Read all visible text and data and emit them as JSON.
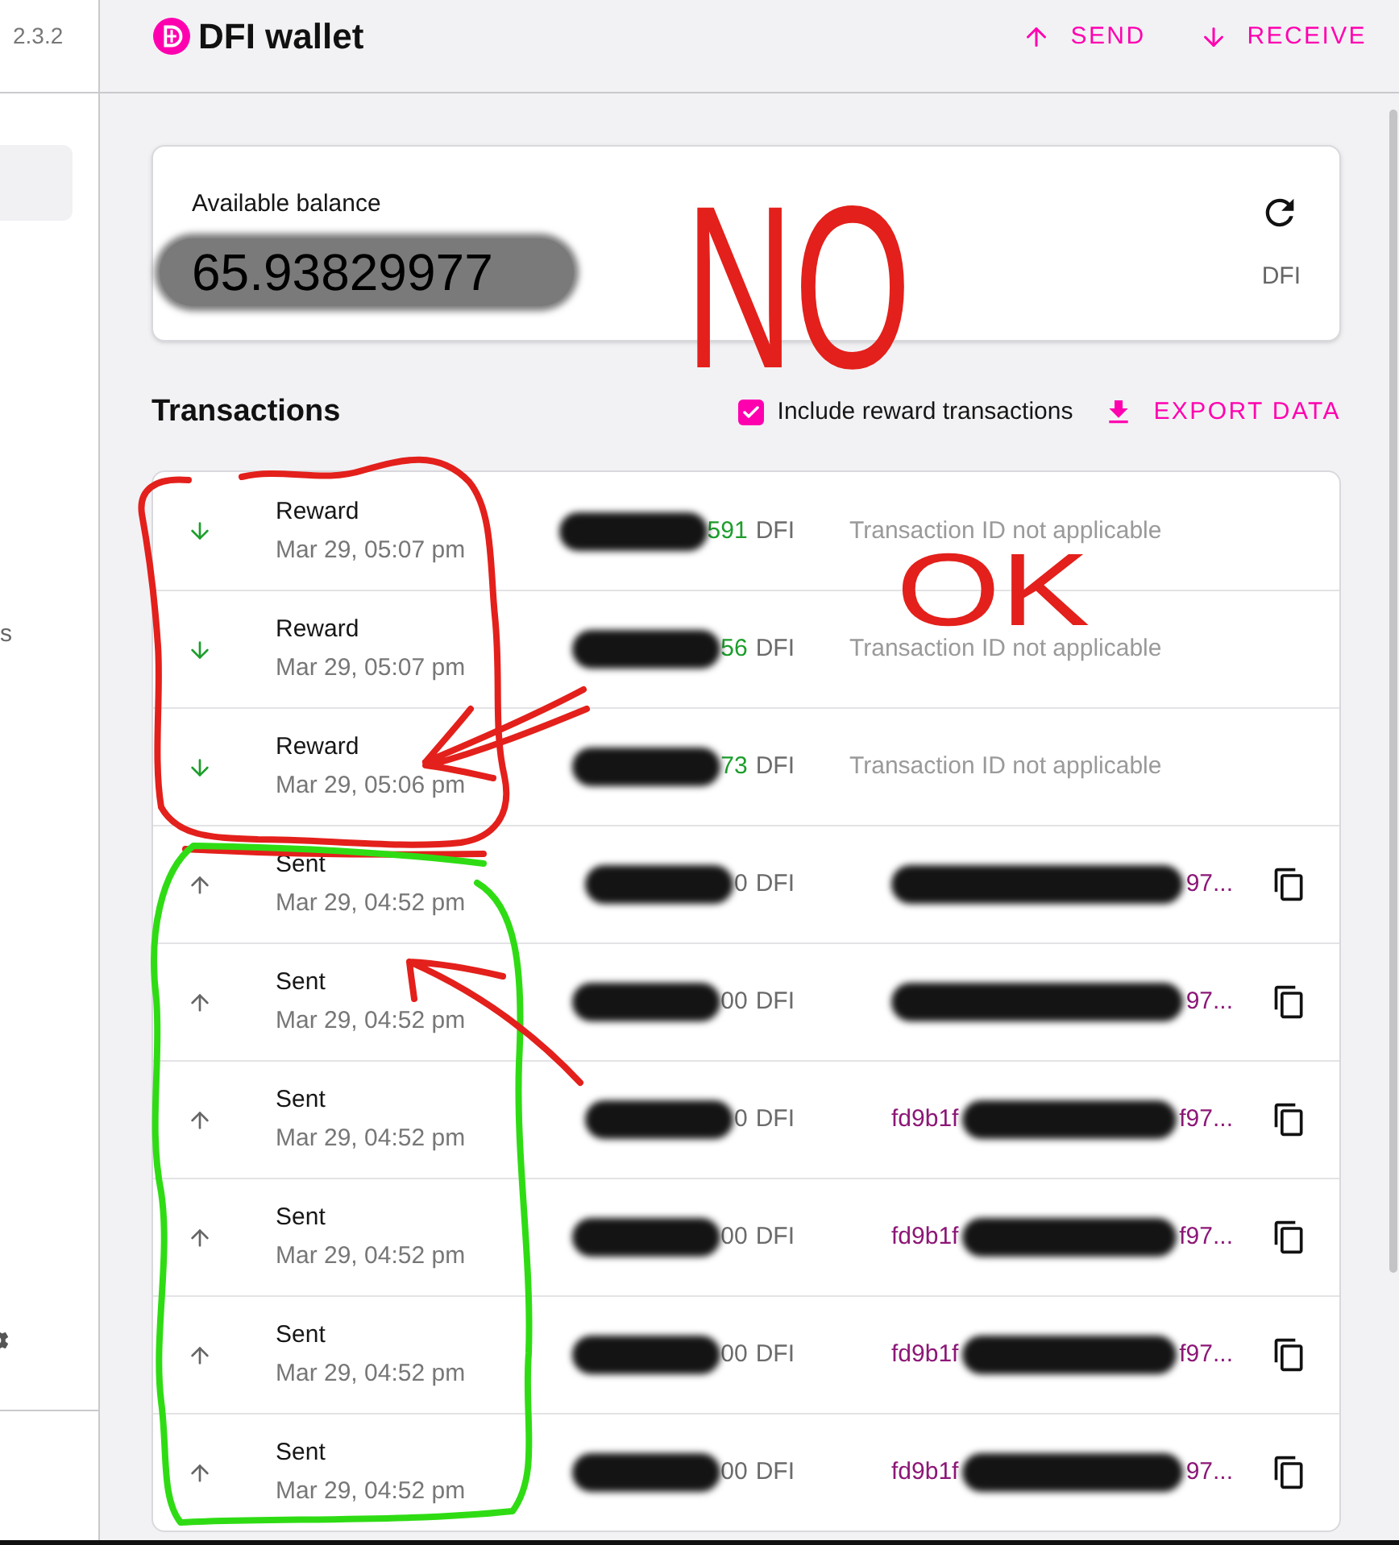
{
  "sidebar": {
    "version": "2.3.2",
    "items": [
      {
        "selected": true
      },
      {
        "label": "s",
        "selected": false
      }
    ]
  },
  "header": {
    "title": "DFI wallet",
    "actions": [
      {
        "kind": "send",
        "label": "SEND"
      },
      {
        "kind": "receive",
        "label": "RECEIVE"
      }
    ]
  },
  "balance": {
    "label": "Available balance",
    "amount": "65.93829977",
    "unit": "DFI"
  },
  "transactions": {
    "title": "Transactions",
    "filter": {
      "label": "Include reward transactions",
      "checked": true
    },
    "export": "EXPORT DATA",
    "rows": [
      {
        "kind": "reward",
        "type": "Reward",
        "date": "Mar 29, 05:07 pm",
        "amount": "591",
        "unit": "DFI",
        "txid": "Transaction ID not applicable"
      },
      {
        "kind": "reward",
        "type": "Reward",
        "date": "Mar 29, 05:07 pm",
        "amount": "56",
        "unit": "DFI",
        "txid": "Transaction ID not applicable"
      },
      {
        "kind": "reward",
        "type": "Reward",
        "date": "Mar 29, 05:06 pm",
        "amount": "73",
        "unit": "DFI",
        "txid": "Transaction ID not applicable"
      },
      {
        "kind": "sent",
        "type": "Sent",
        "date": "Mar 29, 04:52 pm",
        "amount": "0",
        "unit": "DFI",
        "txid_end": "97..."
      },
      {
        "kind": "sent",
        "type": "Sent",
        "date": "Mar 29, 04:52 pm",
        "amount": "00",
        "unit": "DFI",
        "txid_end": "97..."
      },
      {
        "kind": "sent",
        "type": "Sent",
        "date": "Mar 29, 04:52 pm",
        "amount": "0",
        "unit": "DFI",
        "txid_start": "fd9b1f",
        "txid_end": "f97..."
      },
      {
        "kind": "sent",
        "type": "Sent",
        "date": "Mar 29, 04:52 pm",
        "amount": "00",
        "unit": "DFI",
        "txid_start": "fd9b1f",
        "txid_end": "f97..."
      },
      {
        "kind": "sent",
        "type": "Sent",
        "date": "Mar 29, 04:52 pm",
        "amount": "00",
        "unit": "DFI",
        "txid_start": "fd9b1f",
        "txid_end": "f97..."
      },
      {
        "kind": "sent",
        "type": "Sent",
        "date": "Mar 29, 04:52 pm",
        "amount": "00",
        "unit": "DFI",
        "txid_start": "fd9b1f",
        "txid_end": "97..."
      }
    ]
  },
  "annotations": [
    {
      "kind": "note",
      "text": "NO",
      "color": "#e3201b"
    },
    {
      "kind": "note",
      "text": "OK",
      "color": "#e3201b"
    },
    {
      "kind": "loop",
      "color": "#e3201b"
    },
    {
      "kind": "arrow",
      "color": "#e3201b"
    },
    {
      "kind": "loop",
      "color": "#2fdc14"
    },
    {
      "kind": "arrow",
      "color": "#e3201b"
    }
  ]
}
